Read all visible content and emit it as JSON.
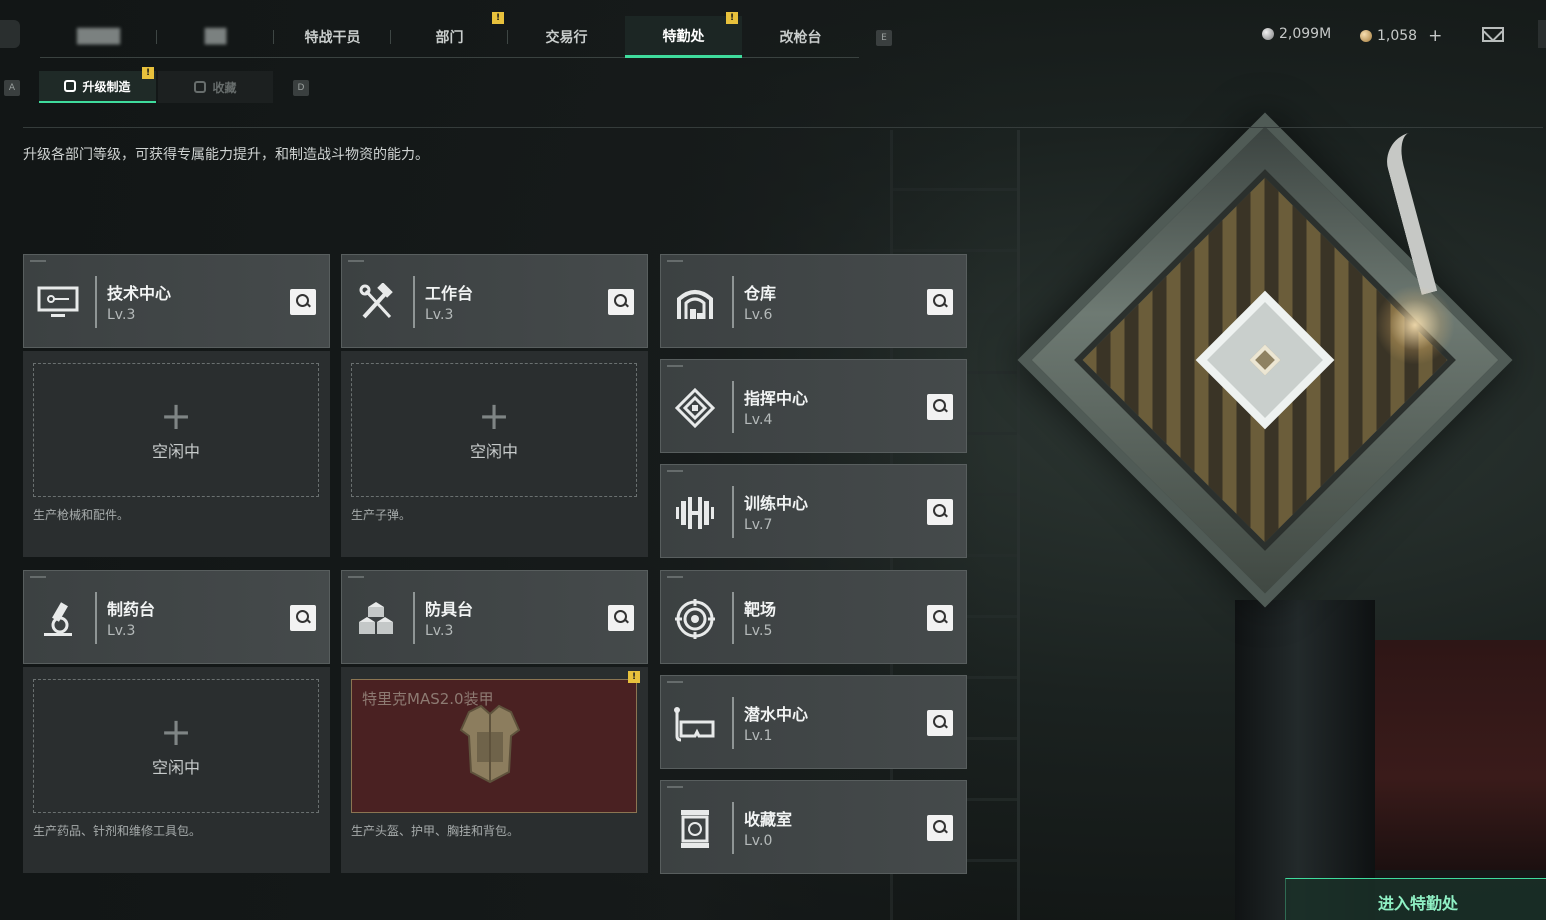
{
  "top_tabs": [
    {
      "label": "",
      "blurred": true
    },
    {
      "label": "",
      "blurred": true
    },
    {
      "label": "特战干员"
    },
    {
      "label": "部门",
      "badge": "!"
    },
    {
      "label": "交易行"
    },
    {
      "label": "特勤处",
      "badge": "!",
      "active": true
    },
    {
      "label": "改枪台"
    }
  ],
  "key_hints": {
    "left_top": "",
    "right_top": "E",
    "left_sub": "A",
    "right_sub": "D"
  },
  "currency": {
    "silver": {
      "value": "2,099M"
    },
    "gold": {
      "value": "1,058",
      "add": "+"
    }
  },
  "sub_tabs": {
    "upgrade": {
      "label": "升级制造",
      "badge": "!"
    },
    "collect": {
      "label": "收藏"
    }
  },
  "description": "升级各部门等级，可获得专属能力提升，和制造战斗物资的能力。",
  "departments": {
    "tech": {
      "name": "技术中心",
      "level": "Lv.3",
      "icon": "monitor-icon"
    },
    "workbench": {
      "name": "工作台",
      "level": "Lv.3",
      "icon": "hammer-wrench-icon"
    },
    "warehouse": {
      "name": "仓库",
      "level": "Lv.6",
      "icon": "warehouse-icon"
    },
    "command": {
      "name": "指挥中心",
      "level": "Lv.4",
      "icon": "command-icon"
    },
    "training": {
      "name": "训练中心",
      "level": "Lv.7",
      "icon": "dumbbell-icon"
    },
    "pharmacy": {
      "name": "制药台",
      "level": "Lv.3",
      "icon": "microscope-icon"
    },
    "armor": {
      "name": "防具台",
      "level": "Lv.3",
      "icon": "cubes-icon"
    },
    "range": {
      "name": "靶场",
      "level": "Lv.5",
      "icon": "target-icon"
    },
    "diving": {
      "name": "潜水中心",
      "level": "Lv.1",
      "icon": "goggles-icon"
    },
    "collection": {
      "name": "收藏室",
      "level": "Lv.0",
      "icon": "display-case-icon"
    }
  },
  "production": {
    "tech": {
      "status": "空闲中",
      "plus": "+",
      "desc": "生产枪械和配件。"
    },
    "workbench": {
      "status": "空闲中",
      "plus": "+",
      "desc": "生产子弹。"
    },
    "pharmacy": {
      "status": "空闲中",
      "plus": "+",
      "desc": "生产药品、针剂和维修工具包。"
    },
    "armor": {
      "item": "特里克MAS2.0装甲",
      "badge": "!",
      "desc": "生产头盔、护甲、胸挂和背包。"
    }
  },
  "enter_button": "进入特勤处",
  "colors": {
    "accent": "#3fdc9d",
    "badge": "#e8c13c",
    "card": "#404546",
    "item_bg": "#4a2122"
  }
}
